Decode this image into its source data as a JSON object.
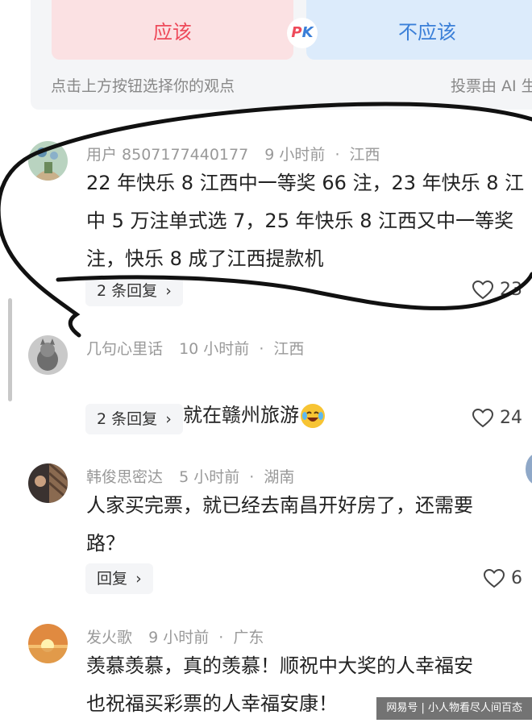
{
  "pk": {
    "yes_label": "应该",
    "no_label": "不应该",
    "badge_p": "P",
    "badge_k": "K",
    "hint": "点击上方按钮选择你的观点",
    "note": "投票由 AI 生"
  },
  "comments": [
    {
      "user": "用户 8507177440177",
      "time": "9 小时前",
      "location": "江西",
      "text": "22 年快乐 8 江西中一等奖 66 注，23 年快乐 8 江\n中 5 万注单式选 7，25 年快乐 8 江西又中一等奖\n注，快乐 8 成了江西提款机",
      "reply_label": "2 条回复",
      "likes": "23"
    },
    {
      "user": "几句心里话",
      "time": "10 小时前",
      "location": "江西",
      "text": "主任会不会就在赣州旅游",
      "reply_label": "2 条回复",
      "likes": "24"
    },
    {
      "user": "韩俊思密达",
      "time": "5 小时前",
      "location": "湖南",
      "text": "人家买完票，就已经去南昌开好房了，还需要\n路？",
      "reply_label": "回复",
      "likes": "6"
    },
    {
      "user": "发火歌",
      "time": "9 小时前",
      "location": "广东",
      "text": "羡慕羡慕，真的羡慕！顺祝中大奖的人幸福安\n也祝福买彩票的人幸福安康！"
    }
  ],
  "meta_sep": "·",
  "reply_chevron": "›",
  "watermark": "网易号 | 小人物看尽人间百态",
  "colors": {
    "yes": "#ee4a5a",
    "no": "#3a7fd8",
    "panel_bg": "#f4f5f7"
  }
}
